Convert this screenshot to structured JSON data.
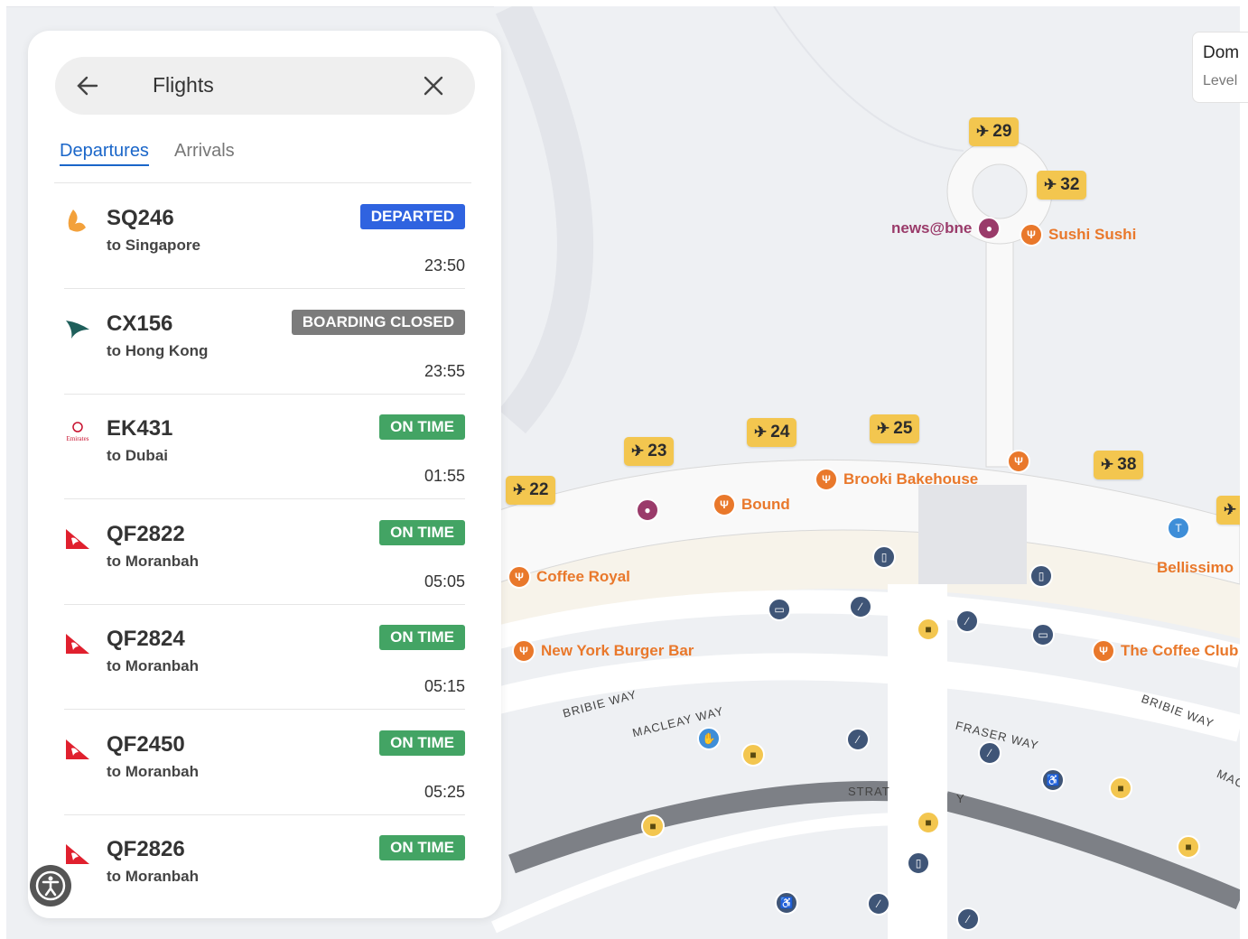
{
  "search": {
    "title": "Flights",
    "back_icon": "arrow-left-icon",
    "close_icon": "close-icon"
  },
  "tabs": [
    {
      "label": "Departures",
      "active": true
    },
    {
      "label": "Arrivals",
      "active": false
    }
  ],
  "flights": [
    {
      "code": "SQ246",
      "destination": "to Singapore",
      "status": "DEPARTED",
      "status_color": "#2f63e0",
      "time": "23:50",
      "airline_logo": "singapore-airlines-logo-icon"
    },
    {
      "code": "CX156",
      "destination": "to Hong Kong",
      "status": "BOARDING CLOSED",
      "status_color": "#7b7b7b",
      "time": "23:55",
      "airline_logo": "cathay-pacific-logo-icon"
    },
    {
      "code": "EK431",
      "destination": "to Dubai",
      "status": "ON TIME",
      "status_color": "#43a464",
      "time": "01:55",
      "airline_logo": "emirates-logo-icon",
      "logo_text": "Emirates"
    },
    {
      "code": "QF2822",
      "destination": "to Moranbah",
      "status": "ON TIME",
      "status_color": "#43a464",
      "time": "05:05",
      "airline_logo": "qantas-logo-icon"
    },
    {
      "code": "QF2824",
      "destination": "to Moranbah",
      "status": "ON TIME",
      "status_color": "#43a464",
      "time": "05:15",
      "airline_logo": "qantas-logo-icon"
    },
    {
      "code": "QF2450",
      "destination": "to Moranbah",
      "status": "ON TIME",
      "status_color": "#43a464",
      "time": "05:25",
      "airline_logo": "qantas-logo-icon"
    },
    {
      "code": "QF2826",
      "destination": "to Moranbah",
      "status": "ON TIME",
      "status_color": "#43a464",
      "time": "",
      "airline_logo": "qantas-logo-icon"
    }
  ],
  "map": {
    "level_card": {
      "title": "Dom",
      "subtitle": "Level"
    },
    "gates": [
      "29",
      "32",
      "24",
      "25",
      "23",
      "22",
      "38",
      ""
    ],
    "pois": {
      "news": "news@bne",
      "sushi": "Sushi Sushi",
      "brooki": "Brooki Bakehouse",
      "bound": "Bound",
      "coffee_royal": "Coffee Royal",
      "bellissimo": "Bellissimo",
      "nyburger": "New York Burger Bar",
      "coffee_club": "The Coffee Club"
    },
    "streets": {
      "bribie_left": "BRIBIE WAY",
      "macleay": "MACLEAY WAY",
      "fraser": "FRASER WAY",
      "bribie_right": "BRIBIE WAY",
      "mac_right": "MAC",
      "strat": "STRAT",
      "y": "Y"
    }
  },
  "colors": {
    "accent": "#1a66c9",
    "on_time": "#43a464",
    "departed": "#2f63e0",
    "closed": "#7b7b7b",
    "gate": "#f3c64f",
    "food": "#e9782b"
  },
  "accessibility_icon": "accessibility-icon"
}
